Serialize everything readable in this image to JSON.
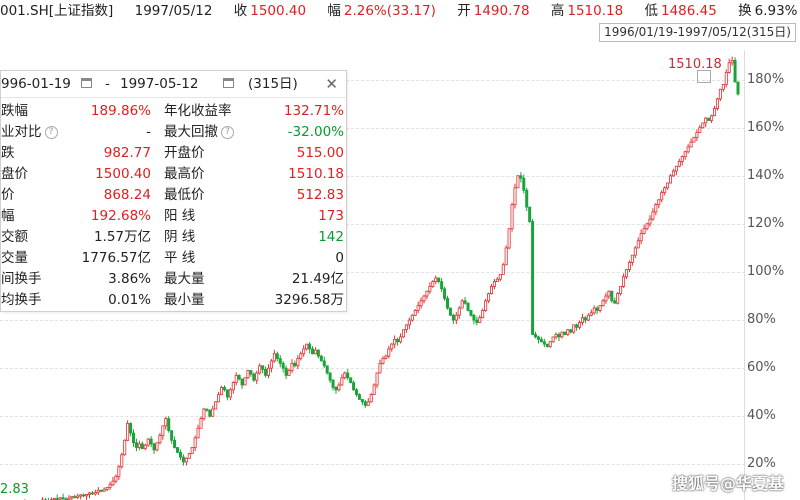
{
  "header": {
    "code": "001.SH[上证指数]",
    "date": "1997/05/12",
    "close_label": "收",
    "close_value": "1500.40",
    "change_label": "幅",
    "change_value": "2.26%(33.17)",
    "open_label": "开",
    "open_value": "1490.78",
    "high_label": "高",
    "high_value": "1510.18",
    "low_label": "低",
    "low_value": "1486.45",
    "turnover_label": "换",
    "turnover_value": "6.93%",
    "range_text": "1996/01/19-1997/05/12(315日)"
  },
  "panel": {
    "start_date": "996-01-19",
    "end_date": "1997-05-12",
    "dash": "-",
    "days": "(315日)",
    "close": "✕",
    "rows": [
      {
        "l1": "跌幅",
        "v1": "189.86%",
        "l2": "年化收益率",
        "v2": "132.71%",
        "c1": "red",
        "c2": "red"
      },
      {
        "l1": "业对比",
        "v1": "-",
        "l2": "最大回撤",
        "v2": "-32.00%",
        "c1": "dark",
        "c2": "green",
        "q1": true,
        "q2": true
      },
      {
        "l1": "跌",
        "v1": "982.77",
        "l2": "开盘价",
        "v2": "515.00",
        "c1": "red",
        "c2": "red"
      },
      {
        "l1": "盘价",
        "v1": "1500.40",
        "l2": "最高价",
        "v2": "1510.18",
        "c1": "red",
        "c2": "red"
      },
      {
        "l1": "价",
        "v1": "868.24",
        "l2": "最低价",
        "v2": "512.83",
        "c1": "red",
        "c2": "red"
      },
      {
        "l1": "幅",
        "v1": "192.68%",
        "l2": "阳 线",
        "v2": "173",
        "c1": "red",
        "c2": "red"
      },
      {
        "l1": "交额",
        "v1": "1.57万亿",
        "l2": "阴 线",
        "v2": "142",
        "c1": "dark",
        "c2": "green"
      },
      {
        "l1": "交量",
        "v1": "1776.57亿",
        "l2": "平 线",
        "v2": "0",
        "c1": "dark",
        "c2": "dark"
      },
      {
        "l1": "间换手",
        "v1": "3.86%",
        "l2": "最大量",
        "v2": "21.49亿",
        "c1": "dark",
        "c2": "dark"
      },
      {
        "l1": "均换手",
        "v1": "0.01%",
        "l2": "最小量",
        "v2": "3296.58万",
        "c1": "dark",
        "c2": "dark"
      }
    ]
  },
  "chart_data": {
    "type": "candlestick",
    "y_axis_unit": "%",
    "y_ticks": [
      "180%",
      "160%",
      "140%",
      "120%",
      "100%",
      "80%",
      "60%",
      "40%",
      "20%"
    ],
    "y_tick_values": [
      180,
      160,
      140,
      120,
      100,
      80,
      60,
      40,
      20
    ],
    "ylim": [
      6,
      189
    ],
    "high_label": "1510.18",
    "low_label": "2.83",
    "up_color": "#e03030",
    "down_color": "#1aa33a",
    "series_pct": [
      4,
      4.6,
      3.7,
      3.4,
      4.1,
      3.8,
      4.4,
      5.2,
      4.9,
      4.6,
      5.3,
      5.8,
      5.5,
      6.1,
      5.6,
      5.3,
      6,
      6.6,
      6.2,
      6.8,
      7.3,
      6.9,
      7.5,
      8.1,
      7.7,
      8.4,
      9.2,
      8.8,
      9.6,
      10.4,
      11.5,
      13,
      15,
      19,
      24,
      30,
      37,
      33,
      29,
      27,
      28.5,
      26.5,
      28,
      30.5,
      28.5,
      26,
      29,
      32,
      36,
      39,
      34,
      30,
      27,
      25,
      23,
      21,
      22.5,
      24.5,
      27,
      31,
      35,
      39,
      43,
      42.5,
      40,
      43,
      46,
      49,
      52,
      51,
      48,
      51,
      54,
      57,
      55.5,
      53,
      56,
      59,
      57.5,
      55,
      58,
      61,
      59.5,
      57,
      60,
      63,
      66,
      64,
      62,
      60,
      57,
      59,
      62,
      61,
      64,
      66,
      68,
      70,
      68,
      66,
      67.5,
      65,
      63,
      61,
      58,
      55,
      52,
      51,
      53,
      56,
      58,
      56,
      54,
      51,
      49,
      47,
      46,
      44.5,
      46,
      49,
      53,
      58,
      62,
      64,
      65,
      68,
      70,
      72,
      71,
      73,
      76,
      78,
      80,
      82,
      84,
      86,
      88,
      90,
      92,
      94,
      96,
      97.5,
      96,
      93,
      89,
      85,
      82,
      80,
      82,
      85,
      88,
      87,
      84,
      82,
      80,
      79,
      81,
      84,
      88,
      91,
      94,
      96,
      97,
      99,
      103,
      110,
      118,
      128,
      135,
      140,
      139,
      134,
      127,
      121,
      74,
      73,
      72,
      71,
      70,
      69,
      71,
      73,
      74,
      73,
      75,
      74,
      76,
      75,
      78,
      77,
      79,
      81,
      80,
      82,
      83,
      85,
      84,
      86,
      88,
      90,
      92,
      88,
      87,
      91,
      94,
      98,
      101,
      104,
      107,
      110,
      113,
      116,
      118,
      120,
      122,
      125,
      128,
      130,
      133,
      135,
      137,
      140,
      142,
      144,
      146,
      148,
      150,
      152,
      154,
      156,
      158,
      160,
      162,
      164,
      163,
      165,
      168,
      172,
      176,
      178,
      183,
      187,
      188,
      179,
      174
    ]
  },
  "watermark": "搜狐号@华夏基"
}
